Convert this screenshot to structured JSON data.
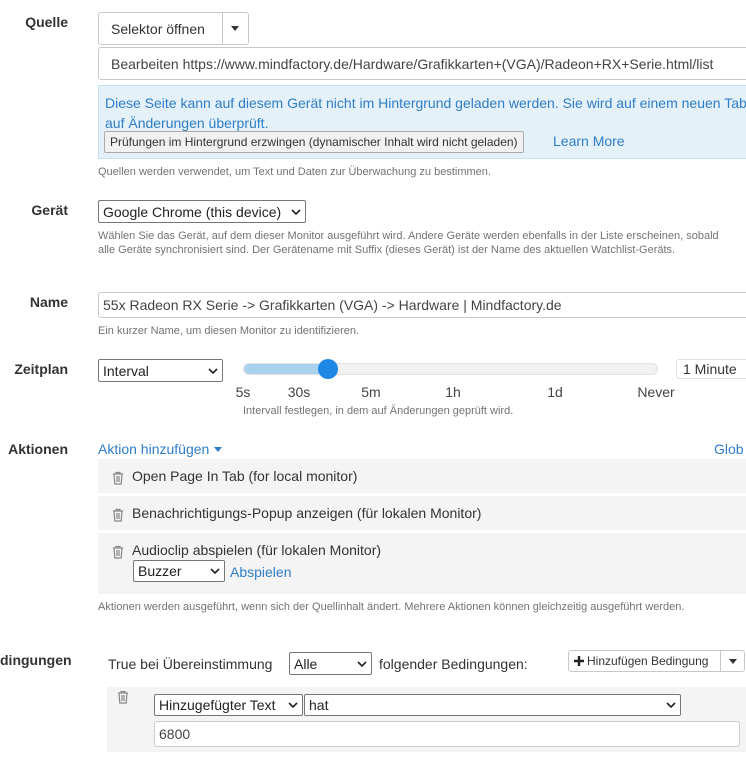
{
  "source": {
    "label": "Quelle",
    "selector_button": "Selektor öffnen",
    "edit_url": "Bearbeiten https://www.mindfactory.de/Hardware/Grafikkarten+(VGA)/Radeon+RX+Serie.html/list",
    "notice_text": "Diese Seite kann auf diesem Gerät nicht im Hintergrund geladen werden. Sie wird auf einem neuen Tab auf Änderungen überprüft.",
    "force_button": "Prüfungen im Hintergrund erzwingen (dynamischer Inhalt wird nicht geladen)",
    "learn_more": "Learn More",
    "help": "Quellen werden verwendet, um Text und Daten zur Überwachung zu bestimmen."
  },
  "device": {
    "label": "Gerät",
    "selected": "Google Chrome (this device)",
    "help": "Wählen Sie das Gerät, auf dem dieser Monitor ausgeführt wird. Andere Geräte werden ebenfalls in der Liste erscheinen, sobald alle Geräte synchronisiert sind. Der Gerätename mit Suffix (dieses Gerät) ist der Name des aktuellen Watchlist-Geräts."
  },
  "name": {
    "label": "Name",
    "value": "55x Radeon RX Serie -> Grafikkarten (VGA) -> Hardware | Mindfactory.de",
    "help": "Ein kurzer Name, um diesen Monitor zu identifizieren."
  },
  "schedule": {
    "label": "Zeitplan",
    "type": "Interval",
    "slider_ticks": [
      "5s",
      "30s",
      "5m",
      "1h",
      "1d",
      "Never"
    ],
    "slider_value_index": 1.4,
    "value_display": "1 Minute",
    "help": "Intervall festlegen, in dem auf Änderungen geprüft wird."
  },
  "actions": {
    "label": "Aktionen",
    "add_link": "Aktion hinzufügen",
    "global_link": "Glob",
    "items": [
      {
        "label": "Open Page In Tab (for local monitor)"
      },
      {
        "label": "Benachrichtigungs-Popup anzeigen (für lokalen Monitor)"
      },
      {
        "label": "Audioclip abspielen (für lokalen Monitor)"
      }
    ],
    "sound_selected": "Buzzer",
    "play_link": "Abspielen",
    "help": "Aktionen werden ausgeführt, wenn sich der Quellinhalt ändert. Mehrere Aktionen können gleichzeitig ausgeführt werden."
  },
  "conditions": {
    "label": "dingungen",
    "prefix": "True bei Übereinstimmung",
    "match_selected": "Alle",
    "suffix": "folgender Bedingungen:",
    "add_button": "Hinzufügen Bedingung",
    "field_selected": "Hinzugefügter Text",
    "operator_selected": "hat",
    "value": "6800"
  },
  "colors": {
    "accent": "#2f7dc8",
    "notice_bg": "#e4f1f8",
    "slider_fill": "#a9d2ef",
    "slider_handle": "#1e88e5"
  }
}
